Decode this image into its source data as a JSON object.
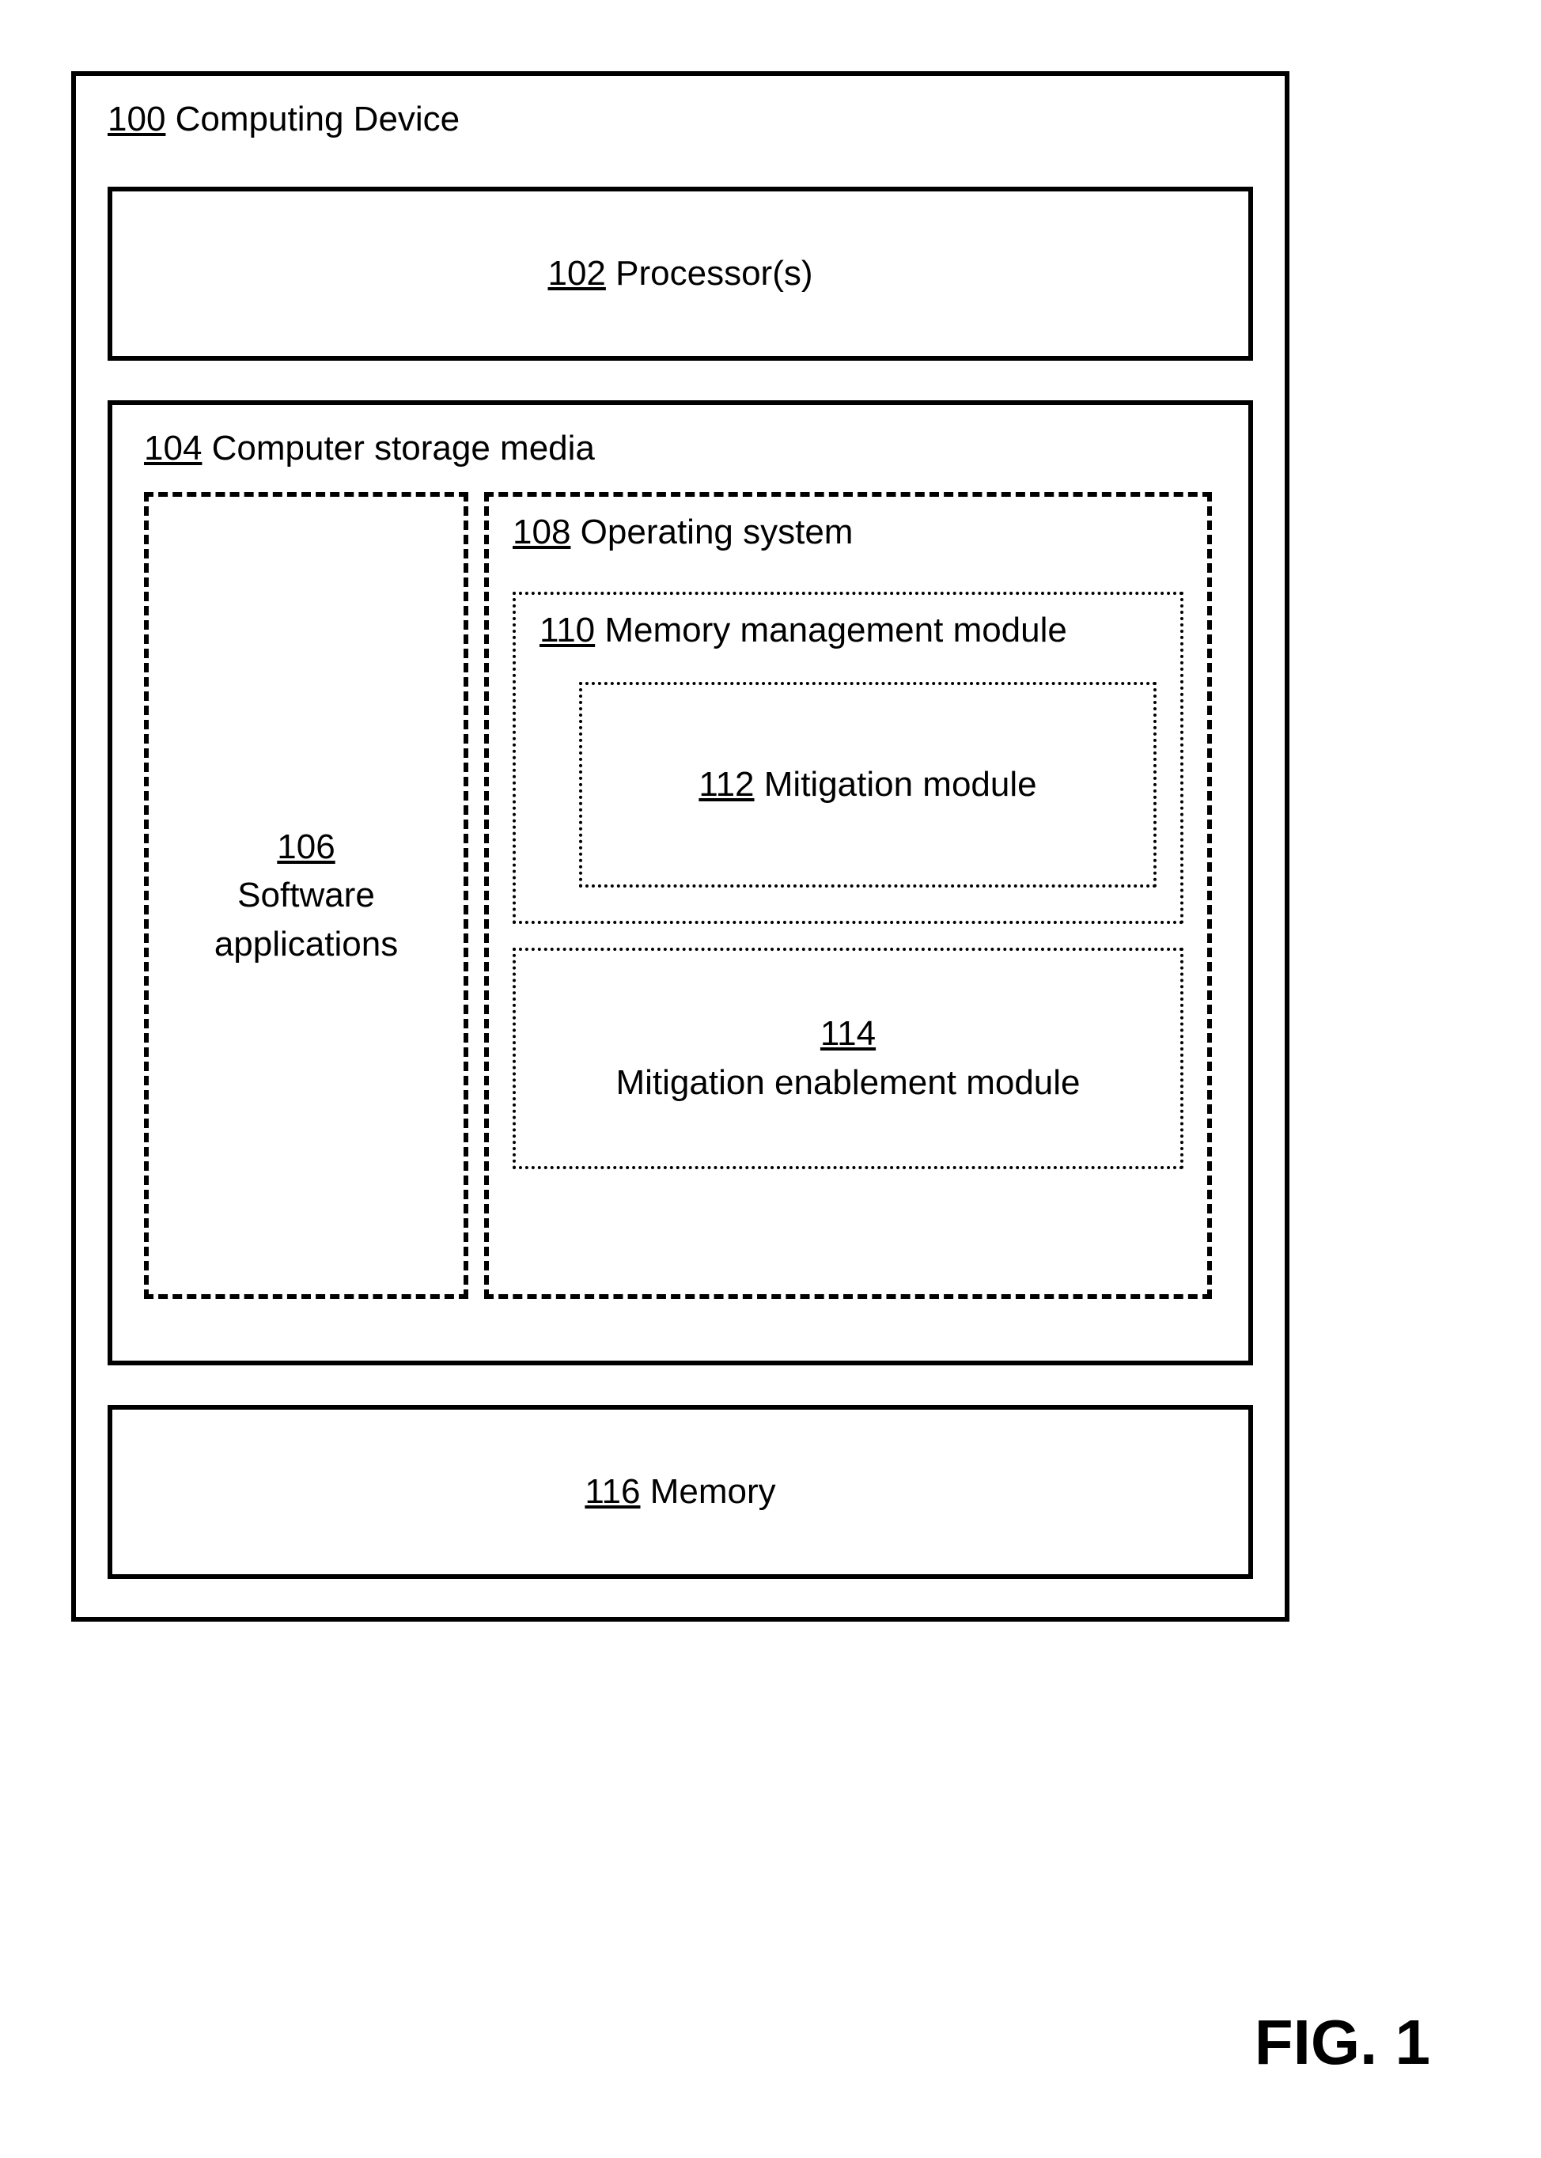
{
  "device": {
    "ref": "100",
    "label": "Computing Device"
  },
  "processor": {
    "ref": "102",
    "label": "Processor(s)"
  },
  "storage": {
    "ref": "104",
    "label": "Computer storage media"
  },
  "software": {
    "ref": "106",
    "label1": "Software",
    "label2": "applications"
  },
  "os": {
    "ref": "108",
    "label": "Operating system"
  },
  "mmm": {
    "ref": "110",
    "label": "Memory management module"
  },
  "mitigation": {
    "ref": "112",
    "label": "Mitigation module"
  },
  "enablement": {
    "ref": "114",
    "label": "Mitigation enablement module"
  },
  "memory": {
    "ref": "116",
    "label": "Memory"
  },
  "figure": "FIG. 1"
}
